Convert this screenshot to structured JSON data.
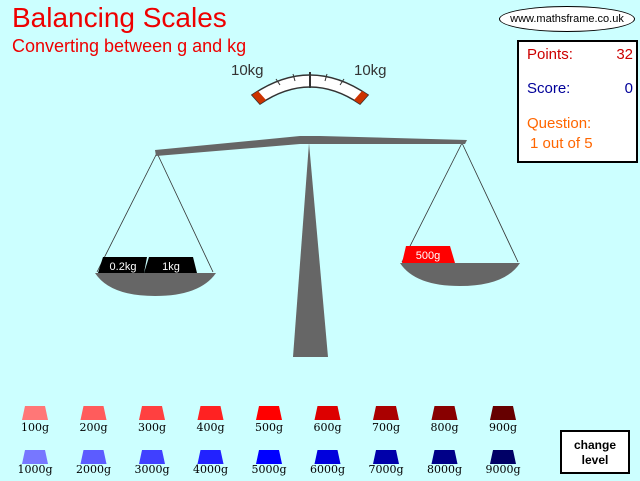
{
  "header": {
    "title": "Balancing Scales",
    "subtitle": "Converting between g and kg"
  },
  "site": "www.mathsframe.co.uk",
  "panel": {
    "points_label": "Points:",
    "points_value": "32",
    "score_label": "Score:",
    "score_value": "0",
    "question_label": "Question:",
    "question_value": "1 out of 5"
  },
  "gauge": {
    "left_label": "10kg",
    "right_label": "10kg"
  },
  "left_pan_weights": [
    "0.2kg",
    "1kg"
  ],
  "right_pan_weights": [
    "500g"
  ],
  "weights_row1": [
    {
      "label": "100g",
      "color": "#ff7777"
    },
    {
      "label": "200g",
      "color": "#ff5c5c"
    },
    {
      "label": "300g",
      "color": "#ff4040"
    },
    {
      "label": "400g",
      "color": "#ff2222"
    },
    {
      "label": "500g",
      "color": "#ff0000"
    },
    {
      "label": "600g",
      "color": "#dd0000"
    },
    {
      "label": "700g",
      "color": "#aa0000"
    },
    {
      "label": "800g",
      "color": "#880000"
    },
    {
      "label": "900g",
      "color": "#660000"
    }
  ],
  "weights_row2": [
    {
      "label": "1000g",
      "color": "#7777ff"
    },
    {
      "label": "2000g",
      "color": "#5c5cff"
    },
    {
      "label": "3000g",
      "color": "#4040ff"
    },
    {
      "label": "4000g",
      "color": "#2222ff"
    },
    {
      "label": "5000g",
      "color": "#0000ff"
    },
    {
      "label": "6000g",
      "color": "#0000dd"
    },
    {
      "label": "7000g",
      "color": "#0000aa"
    },
    {
      "label": "8000g",
      "color": "#000088"
    },
    {
      "label": "9000g",
      "color": "#000066"
    }
  ],
  "change_level": {
    "line1": "change",
    "line2": "level"
  },
  "colors": {
    "title": "#ee0000",
    "background": "#ccffff",
    "scale": "#666666",
    "points": "#cc0000",
    "score": "#000099",
    "question": "#ff6600"
  }
}
